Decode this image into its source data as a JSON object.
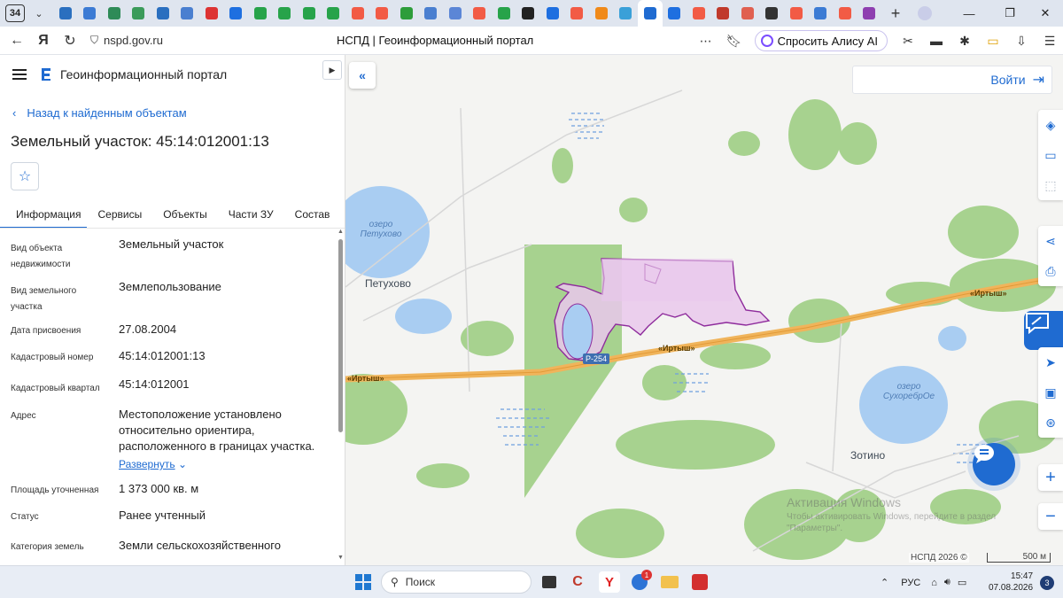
{
  "browser": {
    "tab_count": "34",
    "url": "nspd.gov.ru",
    "page_title": "НСПД | Геоинформационный портал",
    "alice_label": "Спросить Алису AI",
    "tab_favicons": [
      {
        "name": "gosuslugi-favicon",
        "color": "#2a6fbf"
      },
      {
        "name": "globe-favicon",
        "color": "#3c7bd4"
      },
      {
        "name": "emblem-favicon",
        "color": "#2e8b57"
      },
      {
        "name": "emblem-favicon",
        "color": "#3b9b5a"
      },
      {
        "name": "gosuslugi-favicon",
        "color": "#2a6fbf"
      },
      {
        "name": "eagle-favicon",
        "color": "#4a7fd0"
      },
      {
        "name": "flag-favicon",
        "color": "#d33"
      },
      {
        "name": "video-favicon",
        "color": "#1e6fe0"
      },
      {
        "name": "table-favicon",
        "color": "#27a34a"
      },
      {
        "name": "table-favicon",
        "color": "#27a34a"
      },
      {
        "name": "table-favicon",
        "color": "#27a34a"
      },
      {
        "name": "table-favicon",
        "color": "#27a34a"
      },
      {
        "name": "yandex-favicon",
        "color": "#f25b45"
      },
      {
        "name": "yandex-favicon",
        "color": "#f25b45"
      },
      {
        "name": "flag-favicon",
        "color": "#2d9d3a"
      },
      {
        "name": "circle-favicon",
        "color": "#4a7fd0"
      },
      {
        "name": "circle-favicon",
        "color": "#5b86d6"
      },
      {
        "name": "yandex-favicon",
        "color": "#f25b45"
      },
      {
        "name": "table-favicon",
        "color": "#27a34a"
      },
      {
        "name": "eye-favicon",
        "color": "#222"
      },
      {
        "name": "video-favicon",
        "color": "#1e6fe0"
      },
      {
        "name": "yandex-favicon",
        "color": "#f25b45"
      },
      {
        "name": "orange-favicon",
        "color": "#f08a1a"
      },
      {
        "name": "star-favicon",
        "color": "#3aa0d8"
      },
      {
        "name": "nspd-favicon",
        "color": "#1f6bd1"
      },
      {
        "name": "arrow-favicon",
        "color": "#1e6fe0"
      },
      {
        "name": "yandex-favicon",
        "color": "#f25b45"
      },
      {
        "name": "red-circle-favicon",
        "color": "#c0392b"
      },
      {
        "name": "doc-favicon",
        "color": "#e06050"
      },
      {
        "name": "circle-outline-favicon",
        "color": "#333"
      },
      {
        "name": "yandex-favicon",
        "color": "#f25b45"
      },
      {
        "name": "globe-favicon",
        "color": "#3c7bd4"
      },
      {
        "name": "yandex-favicon",
        "color": "#f25b45"
      },
      {
        "name": "purple-favicon",
        "color": "#8e3fb0"
      }
    ]
  },
  "portal": {
    "name": "Геоинформационный портал",
    "back_link": "Назад к найденным объектам",
    "title": "Земельный участок: 45:14:012001:13",
    "tabs": [
      "Информация",
      "Сервисы",
      "Объекты",
      "Части ЗУ",
      "Состав"
    ],
    "attributes": [
      {
        "key": "Вид объекта недвижимости",
        "value": "Земельный участок"
      },
      {
        "key": "Вид земельного участка",
        "value": "Землепользование"
      },
      {
        "key": "Дата присвоения",
        "value": "27.08.2004"
      },
      {
        "key": "Кадастровый номер",
        "value": "45:14:012001:13"
      },
      {
        "key": "Кадастровый квартал",
        "value": "45:14:012001"
      },
      {
        "key": "Адрес",
        "value": "Местоположение установлено относительно ориентира, расположенного в границах участка."
      },
      {
        "key": "Площадь уточненная",
        "value": "1 373 000 кв. м"
      },
      {
        "key": "Статус",
        "value": "Ранее учтенный"
      },
      {
        "key": "Категория земель",
        "value": "Земли сельскохозяйственного"
      }
    ],
    "expand_label": "Развернуть"
  },
  "map": {
    "login_label": "Войти",
    "places": [
      "Петухово",
      "Зотино"
    ],
    "lakes": [
      "озеро\nПетухово",
      "озеро\nСухоребрОе"
    ],
    "road_name": "«Иртыш»",
    "road_code": "Р-254",
    "copyright": "НСПД 2026 ©",
    "scale": "500 м",
    "watermark_title": "Активация Windows",
    "watermark_text": "Чтобы активировать Windows, перейдите в раздел \"Параметры\".",
    "colors": {
      "forest": "#a7d28f",
      "water": "#a9cdf2",
      "road": "#f0b45b",
      "parcel_fill": "#e9c8ec",
      "parcel_stroke": "#8e2c9c",
      "accent": "#1f6bd1"
    }
  },
  "taskbar": {
    "search_label": "Поиск",
    "lang": "РУС",
    "time": "15:47",
    "date": "07.08.2026",
    "notif_count": "3",
    "mail_badge": "1"
  }
}
